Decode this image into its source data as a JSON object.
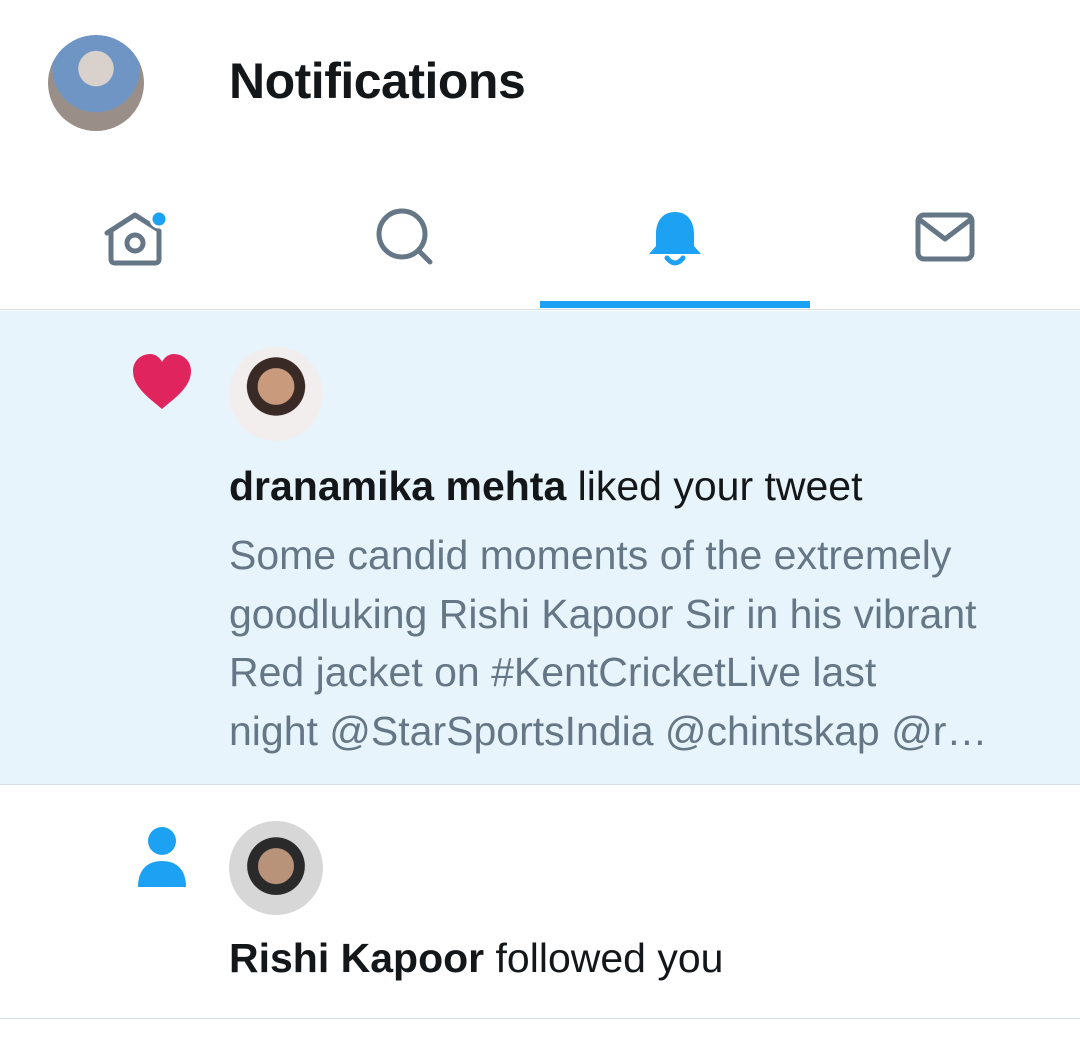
{
  "header": {
    "title": "Notifications"
  },
  "tabs": [
    {
      "id": "home",
      "icon": "home-icon",
      "active": false,
      "has_dot": true
    },
    {
      "id": "search",
      "icon": "search-icon",
      "active": false
    },
    {
      "id": "notifications",
      "icon": "bell-icon",
      "active": true
    },
    {
      "id": "messages",
      "icon": "envelope-icon",
      "active": false
    }
  ],
  "colors": {
    "accent": "#1da1f2",
    "like": "#e0245e",
    "highlight_bg": "#e8f4fb",
    "secondary_text": "#657786",
    "icon_gray": "#657786"
  },
  "notifications": [
    {
      "type": "like",
      "icon": "heart-icon",
      "user_name": "dranamika mehta",
      "action": " liked your tweet",
      "tweet_text": "Some candid moments of the extremely\ngoodluking Rishi Kapoor Sir in his vibrant\nRed jacket on #KentCricketLive last\nnight @StarSportsIndia @chintskap @r…"
    },
    {
      "type": "follow",
      "icon": "person-icon",
      "user_name": "Rishi Kapoor",
      "action": " followed you"
    }
  ]
}
